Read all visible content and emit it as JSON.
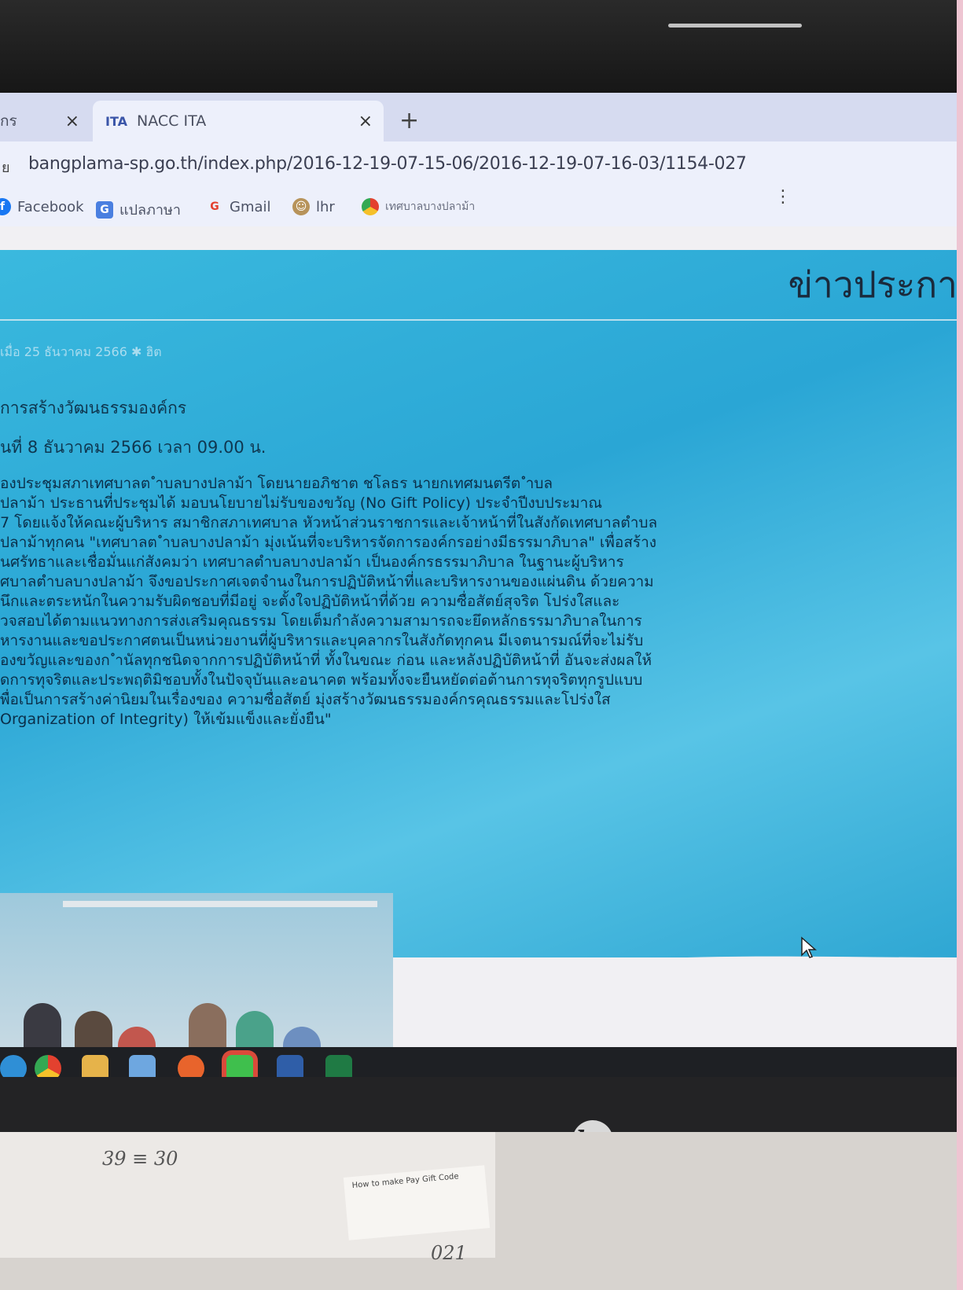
{
  "browser": {
    "tabs": [
      {
        "label": "กร",
        "close": "×"
      },
      {
        "label": "NACC ITA",
        "icon_text": "ITA",
        "close": "×"
      }
    ],
    "new_tab": "+",
    "address_prefix": "ย",
    "url": "bangplama-sp.go.th/index.php/2016-12-19-07-15-06/2016-12-19-07-16-03/1154-027",
    "bookmarks": [
      {
        "label": "Facebook",
        "icon": "facebook-icon",
        "color": "#1877f2"
      },
      {
        "label": "แปลภาษา",
        "icon": "translate-icon",
        "color": "#4a7fe0"
      },
      {
        "label": "Gmail",
        "icon": "google-icon",
        "color": "#e3412f"
      },
      {
        "label": "lhr",
        "icon": "avatar-icon",
        "color": "#b7935a"
      },
      {
        "label": "เทศบาลบางปลาม้า",
        "icon": "chrome-icon",
        "color": "#4a7fe0"
      }
    ],
    "menu_dots": "⋮"
  },
  "page": {
    "site_title": "ข่าวประกา",
    "meta": "เมื่อ 25 ธันวาคม 2566   ✱ ฮิต",
    "article_title": "การสร้างวัฒนธรรมองค์กร",
    "date_line": "นที่ 8 ธันวาคม 2566 เวลา 09.00 น.",
    "body_lines": [
      "องประชุมสภาเทศบาลต ำบลบางปลาม้า โดยนายอภิชาต ชโลธร นายกเทศมนตรีต ำบล",
      "ปลาม้า ประธานที่ประชุมได้ มอบนโยบายไม่รับของขวัญ (No Gift Policy) ประจำปีงบประมาณ",
      "7 โดยแจ้งให้คณะผู้บริหาร สมาชิกสภาเทศบาล หัวหน้าส่วนราชการและเจ้าหน้าที่ในสังกัดเทศบาลตำบล",
      "ปลาม้าทุกคน \"เทศบาลต ำบลบางปลาม้า มุ่งเน้นที่จะบริหารจัดการองค์กรอย่างมีธรรมาภิบาล\" เพื่อสร้าง",
      "นศรัทธาและเชื่อมั่นแก่สังคมว่า เทศบาลตำบลบางปลาม้า เป็นองค์กรธรรมาภิบาล ในฐานะผู้บริหาร",
      "ศบาลตำบลบางปลาม้า จึงขอประกาศเจตจำนงในการปฏิบัติหน้าที่และบริหารงานของแผ่นดิน ด้วยความ",
      "นึกและตระหนักในความรับผิดชอบที่มีอยู่ จะตั้งใจปฏิบัติหน้าที่ด้วย ความซื่อสัตย์สุจริต โปร่งใสและ",
      "วจสอบได้ตามแนวทางการส่งเสริมคุณธรรม โดยเต็มกำลังความสามารถจะยึดหลักธรรมาภิบาลในการ",
      "หารงานและขอประกาศตนเป็นหน่วยงานที่ผู้บริหารและบุคลากรในสังกัดทุกคน มีเจตนารมณ์ที่จะไม่รับ",
      "องขวัญและของก ำนัลทุกชนิดจากการปฏิบัติหน้าที่ ทั้งในขณะ ก่อน และหลังปฏิบัติหน้าที่ อันจะส่งผลให้",
      "ัดการทุจริตและประพฤติมิชอบทั้งในปัจจุบันและอนาคต พร้อมทั้งจะยืนหยัดต่อต้านการทุจริตทุกรูปแบบ",
      "พื่อเป็นการสร้างค่านิยมในเรื่องของ ความซื่อสัตย์ มุ่งสร้างวัฒนธรรมองค์กรคุณธรรมและโปร่งใส",
      "Organization of Integrity) ให้เข้มแข็งและยั่งยืน\""
    ]
  },
  "taskbar": [
    {
      "name": "edge-icon",
      "color": "#2f8fd6"
    },
    {
      "name": "chrome-icon",
      "color": "#e8c53a"
    },
    {
      "name": "file-explorer-icon",
      "color": "#e6b34a"
    },
    {
      "name": "store-icon",
      "color": "#6ea7e0"
    },
    {
      "name": "firefox-icon",
      "color": "#e8642c"
    },
    {
      "name": "line-icon",
      "color": "#3fbf4d"
    },
    {
      "name": "word-icon",
      "color": "#2f5ea8"
    },
    {
      "name": "excel-icon",
      "color": "#1f7a44"
    }
  ],
  "monitor_brand": "hp",
  "desk_notes": {
    "handwritten_1": "39 ≡ 30",
    "handwritten_2": "021",
    "card_text": "How to make Pay Gift Code"
  }
}
